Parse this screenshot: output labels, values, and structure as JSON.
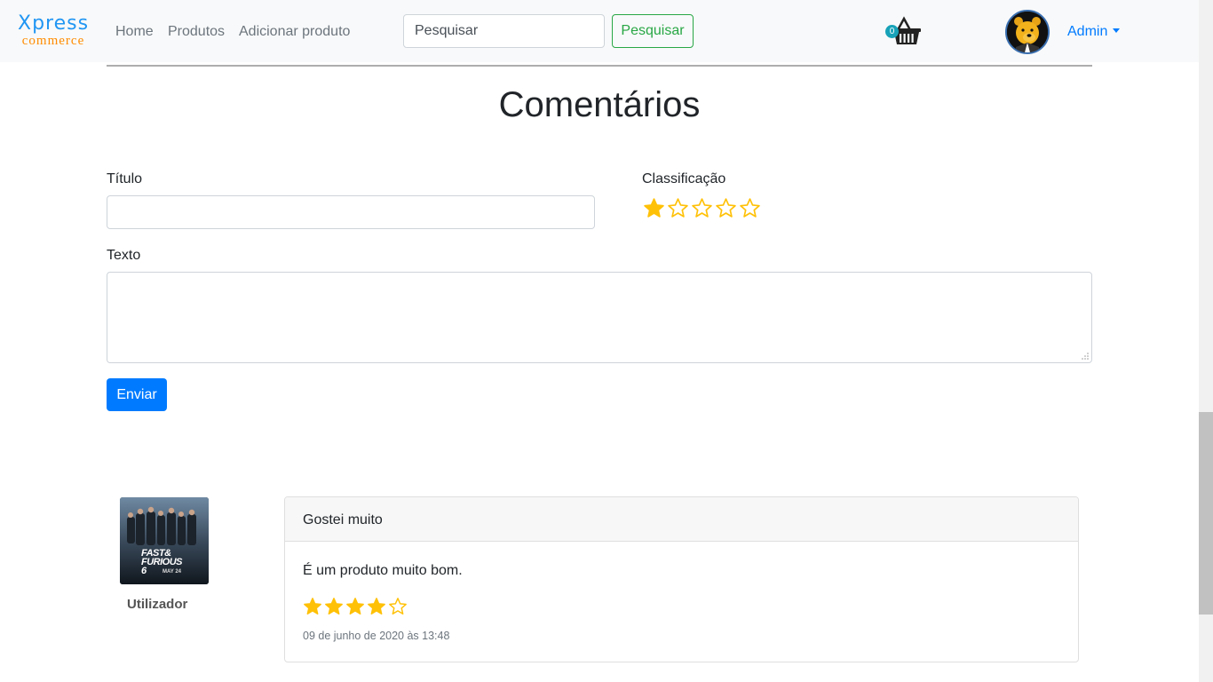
{
  "navbar": {
    "brand_top": "Xpress",
    "brand_bottom": "commerce",
    "links": [
      "Home",
      "Produtos",
      "Adicionar produto"
    ],
    "search_placeholder": "Pesquisar",
    "search_button": "Pesquisar",
    "cart_count": "0",
    "user_menu": "Admin"
  },
  "form": {
    "heading": "Comentários",
    "title_label": "Título",
    "rating_label": "Classificação",
    "rating_value": 1,
    "rating_max": 5,
    "text_label": "Texto",
    "submit_label": "Enviar"
  },
  "review": {
    "poster_title_line1": "FAST&",
    "poster_title_line2": "FURIOUS",
    "poster_title_line3": "6",
    "poster_date": "MAY 24",
    "user": "Utilizador",
    "title": "Gostei muito",
    "text": "É um produto muito bom.",
    "rating_value": 4,
    "rating_max": 5,
    "date": "09 de junho de 2020 às 13:48"
  },
  "colors": {
    "star": "#ffc107",
    "primary": "#007bff",
    "success": "#28a745",
    "badge": "#17a2b8"
  },
  "icons": [
    "cart-basket-icon",
    "star-icon",
    "avatar-bear-icon",
    "chevron-down-icon"
  ]
}
